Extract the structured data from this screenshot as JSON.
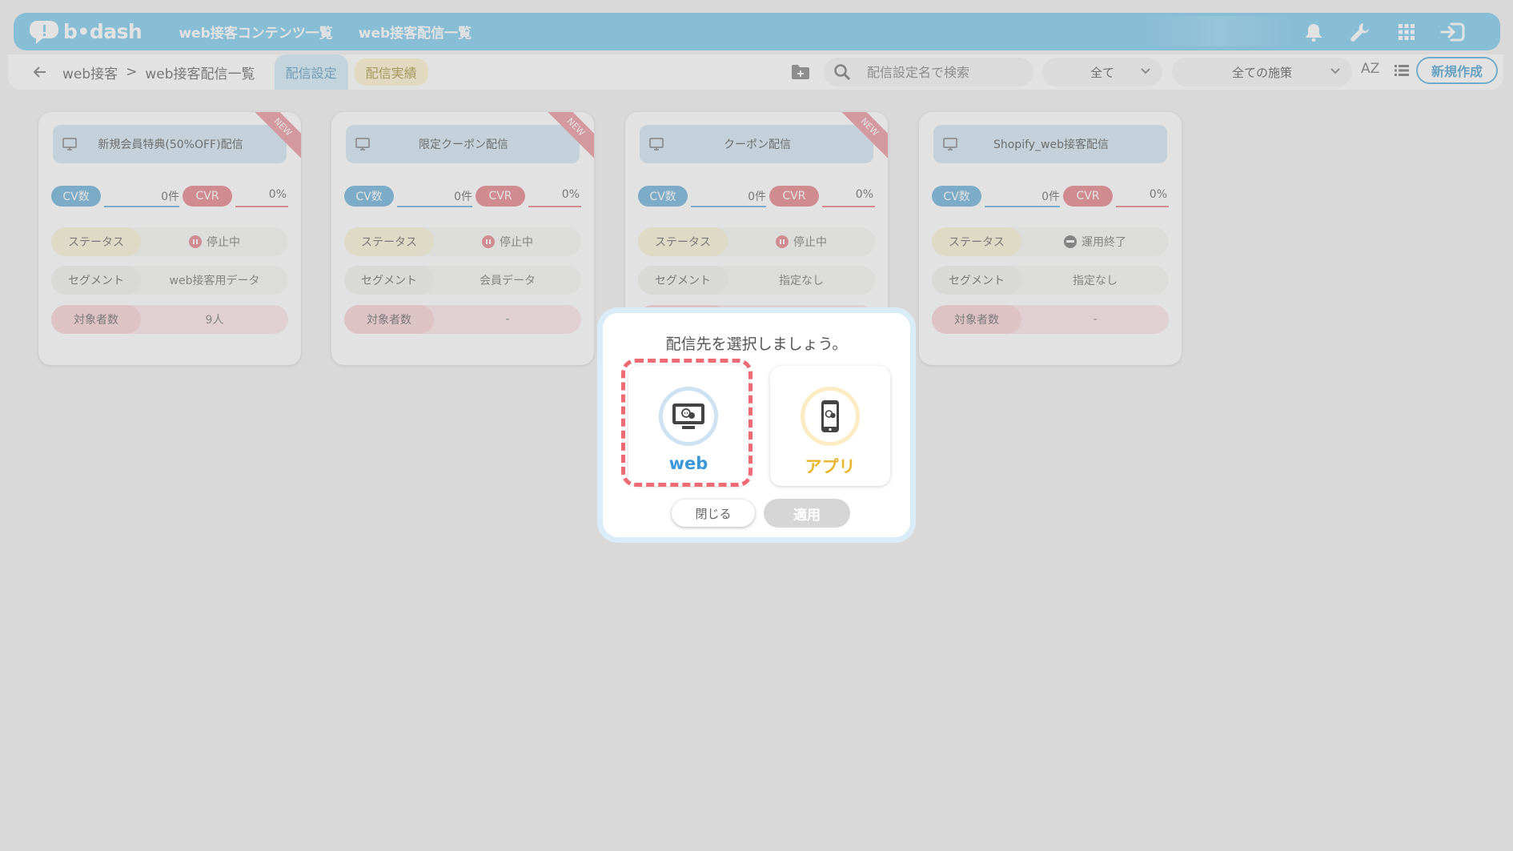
{
  "header": {
    "logo_text": "b•dash",
    "nav": [
      "web接客コンテンツ一覧",
      "web接客配信一覧"
    ]
  },
  "subheader": {
    "breadcrumb": [
      "web接客",
      ">",
      "web接客配信一覧"
    ],
    "tabs": [
      "配信設定",
      "配信実績"
    ],
    "search_placeholder": "配信設定名で検索",
    "filter_all": "全て",
    "filter_policy": "全ての施策",
    "sort_label": "AZ",
    "new_button": "新規作成"
  },
  "labels": {
    "cv": "CV数",
    "cvr": "CVR",
    "status": "ステータス",
    "segment": "セグメント",
    "target": "対象者数"
  },
  "cards": [
    {
      "title": "新規会員特典(50%OFF)配信",
      "new": "NEW",
      "cv": "0件",
      "cvr": "0%",
      "status": "停止中",
      "segment": "web接客用データ",
      "target": "9人"
    },
    {
      "title": "限定クーポン配信",
      "new": "NEW",
      "cv": "0件",
      "cvr": "0%",
      "status": "停止中",
      "segment": "会員データ",
      "target": "-"
    },
    {
      "title": "クーポン配信",
      "new": "NEW",
      "cv": "0件",
      "cvr": "0%",
      "status": "停止中",
      "segment": "指定なし",
      "target": "-"
    },
    {
      "title": "Shopify_web接客配信",
      "new": "",
      "cv": "0件",
      "cvr": "0%",
      "status": "運用終了",
      "segment": "指定なし",
      "target": "-"
    }
  ],
  "modal": {
    "title": "配信先を選択しましょう。",
    "option_web": "web",
    "option_app": "アプリ",
    "close": "閉じる",
    "apply": "適用"
  },
  "colors": {
    "brand": "#6cc3ea",
    "cv": "#5aa6d3",
    "cvr": "#e3737b",
    "highlight": "#ee6b76"
  }
}
